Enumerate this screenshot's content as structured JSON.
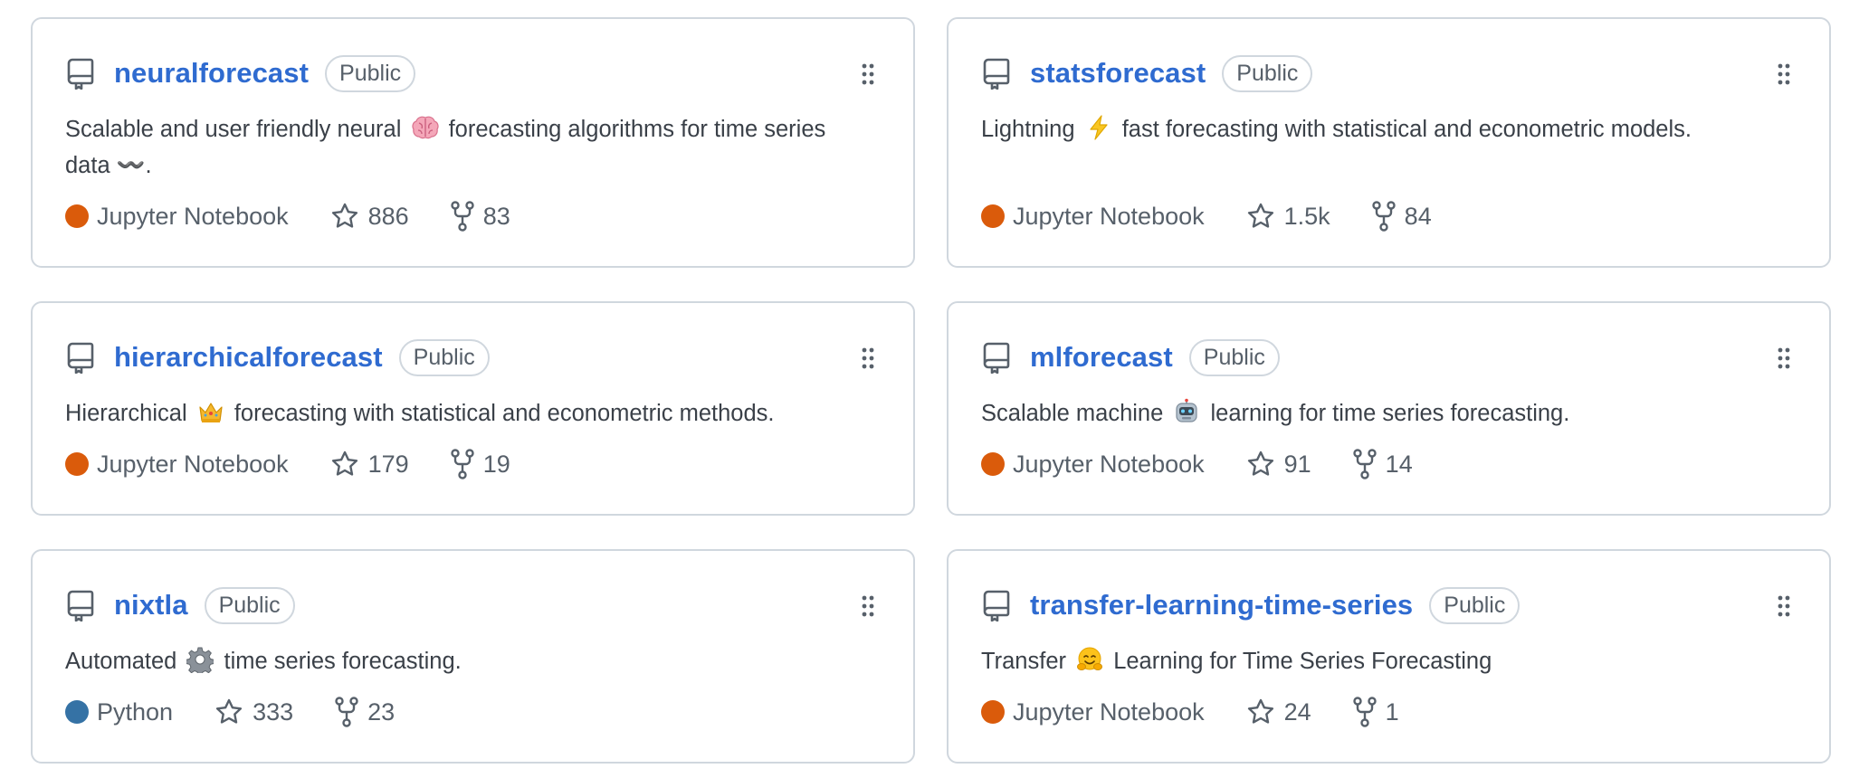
{
  "repos": [
    {
      "name": "neuralforecast",
      "visibility": "Public",
      "desc_before": "Scalable and user friendly neural",
      "desc_emoji": "brain-emoji",
      "desc_after": "forecasting algorithms for time series data 〰️.",
      "language": "Jupyter Notebook",
      "language_color": "#DA5B0B",
      "stars": "886",
      "forks": "83"
    },
    {
      "name": "statsforecast",
      "visibility": "Public",
      "desc_before": "Lightning",
      "desc_emoji": "zap-emoji",
      "desc_after": "fast forecasting with statistical and econometric models.",
      "language": "Jupyter Notebook",
      "language_color": "#DA5B0B",
      "stars": "1.5k",
      "forks": "84"
    },
    {
      "name": "hierarchicalforecast",
      "visibility": "Public",
      "desc_before": "Hierarchical",
      "desc_emoji": "crown-emoji",
      "desc_after": "forecasting with statistical and econometric methods.",
      "language": "Jupyter Notebook",
      "language_color": "#DA5B0B",
      "stars": "179",
      "forks": "19"
    },
    {
      "name": "mlforecast",
      "visibility": "Public",
      "desc_before": "Scalable machine",
      "desc_emoji": "robot-emoji",
      "desc_after": "learning for time series forecasting.",
      "language": "Jupyter Notebook",
      "language_color": "#DA5B0B",
      "stars": "91",
      "forks": "14"
    },
    {
      "name": "nixtla",
      "visibility": "Public",
      "desc_before": "Automated",
      "desc_emoji": "gear-emoji",
      "desc_after": "time series forecasting.",
      "language": "Python",
      "language_color": "#3572A5",
      "stars": "333",
      "forks": "23"
    },
    {
      "name": "transfer-learning-time-series",
      "visibility": "Public",
      "desc_before": "Transfer",
      "desc_emoji": "hugging-face-emoji",
      "desc_after": "Learning for Time Series Forecasting",
      "language": "Jupyter Notebook",
      "language_color": "#DA5B0B",
      "stars": "24",
      "forks": "1"
    }
  ],
  "icons": {
    "repo": "repo-icon",
    "grip": "grabber-icon",
    "star": "star-icon",
    "fork": "repo-forked-icon"
  }
}
